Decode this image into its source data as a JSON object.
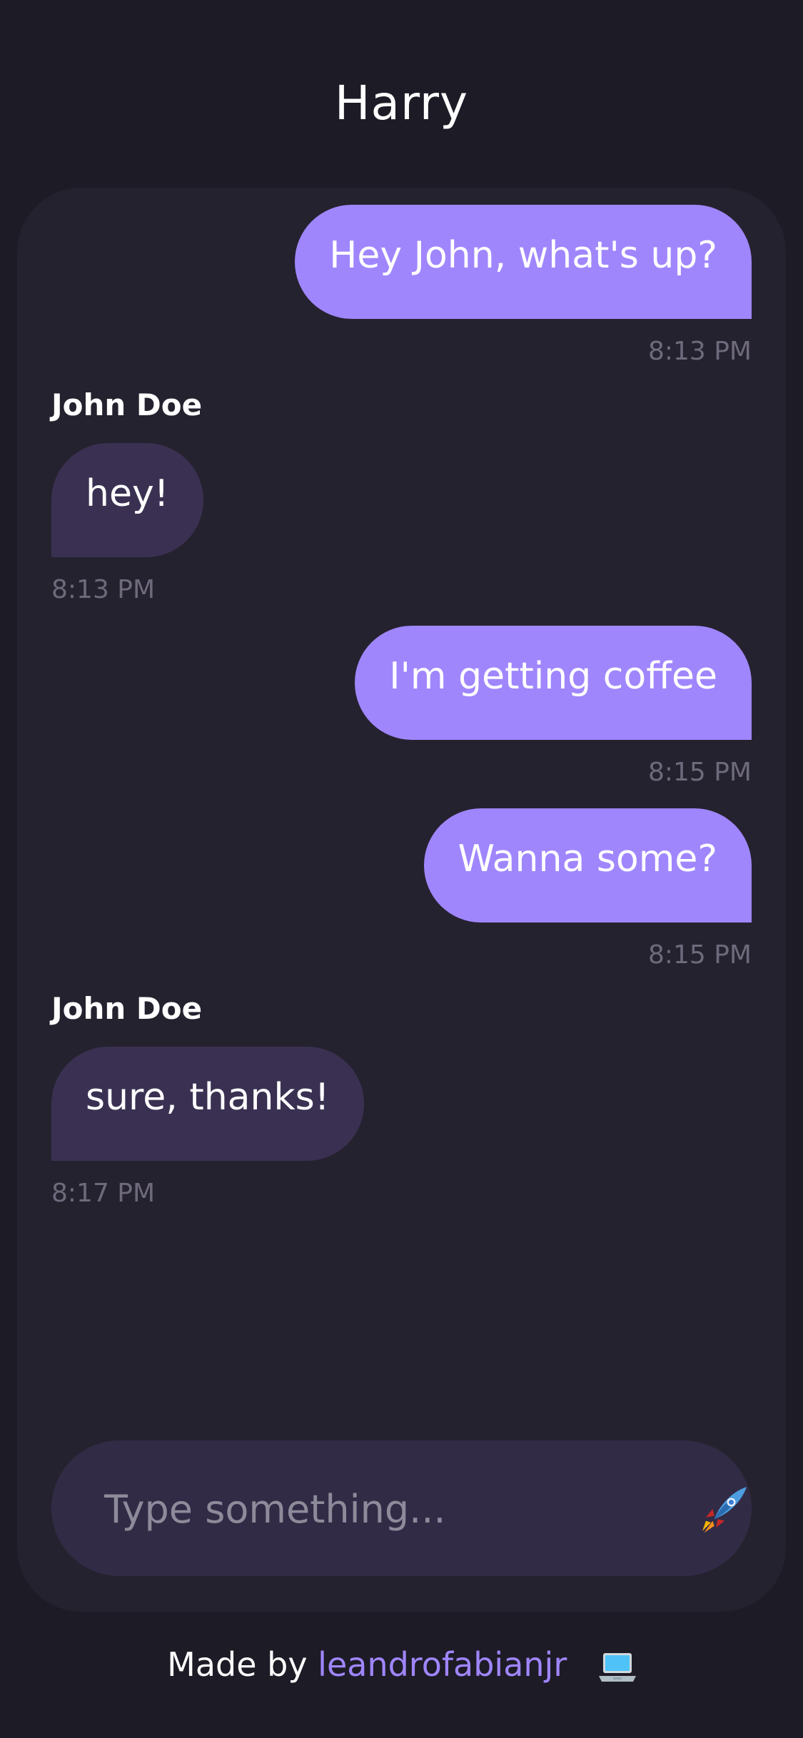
{
  "header": {
    "title": "Harry"
  },
  "messages": [
    {
      "direction": "sent",
      "sender": "",
      "text": "Hey John, what's up?",
      "time": "8:13 PM"
    },
    {
      "direction": "received",
      "sender": "John Doe",
      "text": "hey!",
      "time": "8:13 PM"
    },
    {
      "direction": "sent",
      "sender": "",
      "text": "I'm getting coffee",
      "time": "8:15 PM"
    },
    {
      "direction": "sent",
      "sender": "",
      "text": "Wanna some?",
      "time": "8:15 PM"
    },
    {
      "direction": "received",
      "sender": "John Doe",
      "text": "sure, thanks!",
      "time": "8:17 PM"
    }
  ],
  "composer": {
    "placeholder": "Type something...",
    "value": "",
    "send_icon": "rocket-icon"
  },
  "footer": {
    "made_by": "Made by",
    "author": "leandrofabianjr",
    "icon": "laptop-icon"
  },
  "colors": {
    "background": "#1d1b26",
    "card": "#25222f",
    "sent_bubble": "#a086fd",
    "received_bubble": "#3a3152",
    "accent": "#a086fd"
  }
}
